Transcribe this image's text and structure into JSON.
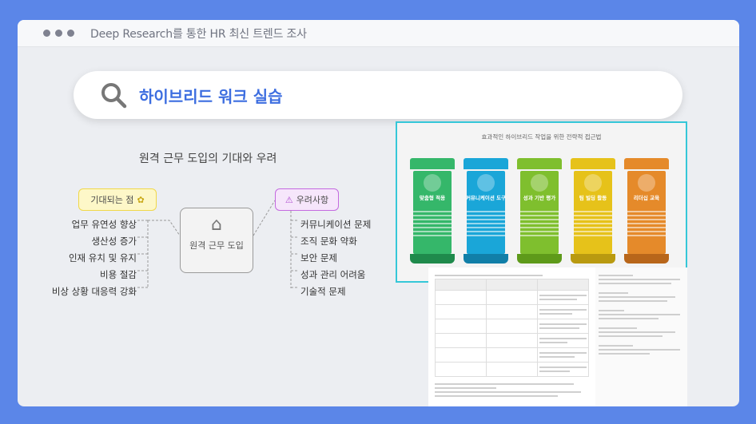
{
  "window": {
    "title": "Deep Research를 통한 HR 최신 트렌드 조사"
  },
  "search": {
    "query": "하이브리드 워크 실습",
    "icon": "search-icon"
  },
  "mindmap": {
    "title": "원격 근무 도입의 기대와 우려",
    "center": "원격 근무 도입",
    "expect_label": "기대되는 점",
    "concern_label": "우려사항",
    "expectations": [
      "업무 유연성 향상",
      "생산성 증가",
      "인재 유치 및 유지",
      "비용 절감",
      "비상 상황 대응력 강화"
    ],
    "concerns": [
      "커뮤니케이션 문제",
      "조직 문화 약화",
      "보안 문제",
      "성과 관리 어려움",
      "기술적 문제"
    ]
  },
  "infographic": {
    "title": "효과적인 하이브리드 작업을 위한 전략적 접근법",
    "cards": [
      {
        "heading": "맞춤형 적용",
        "color": "#35b76a",
        "dark": "#1f8a4c"
      },
      {
        "heading": "커뮤니케이션 도구",
        "color": "#1aa6d8",
        "dark": "#117fa8"
      },
      {
        "heading": "성과 기반 평가",
        "color": "#7fbf2e",
        "dark": "#5e9a1a"
      },
      {
        "heading": "팀 빌딩 활동",
        "color": "#e6c21a",
        "dark": "#b99a10"
      },
      {
        "heading": "리더십 교육",
        "color": "#e58a2a",
        "dark": "#b8661a"
      }
    ]
  },
  "colors": {
    "background": "#5b86e8",
    "accent": "#3d6ee0",
    "highlight_border": "#35c7d8"
  }
}
